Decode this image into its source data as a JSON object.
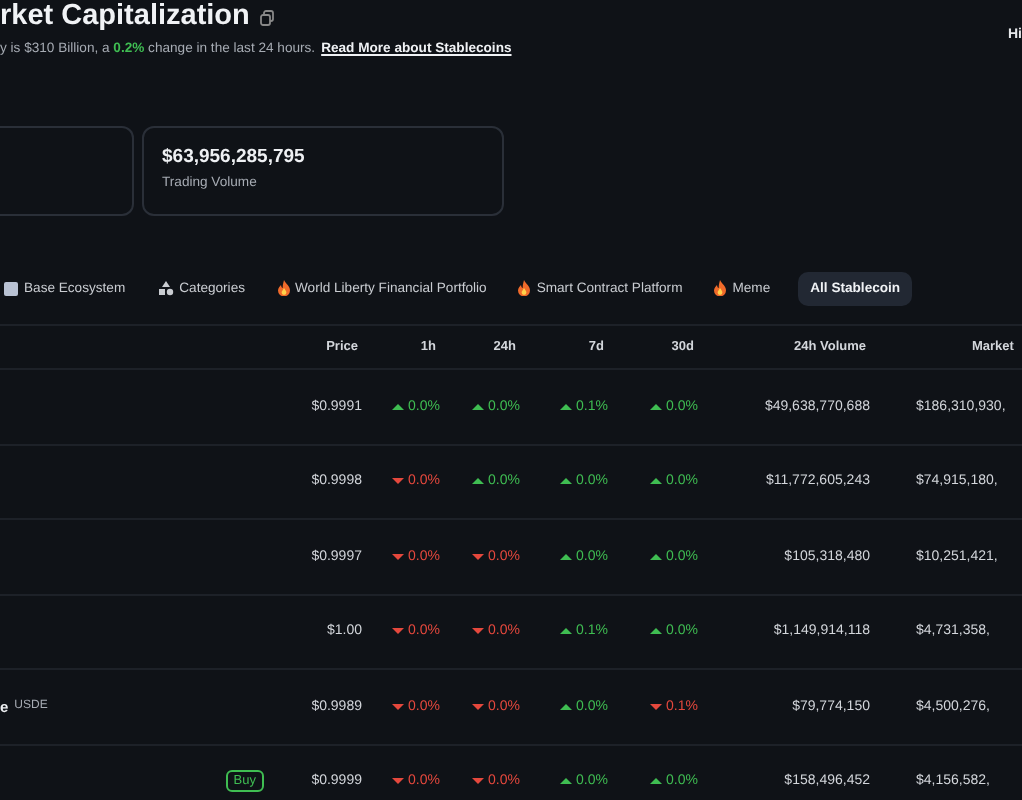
{
  "header": {
    "title": "rket Capitalization",
    "subtitle": {
      "before": "y is $310 Billion, a ",
      "highlight": "0.2%",
      "after": " change in the last 24 hours."
    },
    "link": "Read More about Stablecoins",
    "corner_text": "Hi"
  },
  "cards": [
    {
      "kind": "partial"
    },
    {
      "value": "$63,956,285,795",
      "label": "Trading Volume"
    }
  ],
  "tabs": [
    {
      "label": "Base Ecosystem",
      "kind": "square",
      "selected": false
    },
    {
      "label": "Categories",
      "kind": "shapes",
      "selected": false
    },
    {
      "label": "World Liberty Financial Portfolio",
      "kind": "fire",
      "selected": false
    },
    {
      "label": "Smart Contract Platform",
      "kind": "fire",
      "selected": false
    },
    {
      "label": "Meme",
      "kind": "fire",
      "selected": false
    },
    {
      "label": "All Stablecoin",
      "kind": "plain",
      "selected": true
    }
  ],
  "table": {
    "columns": [
      "Price",
      "1h",
      "24h",
      "7d",
      "30d",
      "24h Volume",
      "Market"
    ],
    "rows": [
      {
        "price": "$0.9991",
        "changes": [
          {
            "value": "0.0%",
            "kind": "up"
          },
          {
            "value": "0.0%",
            "kind": "up"
          },
          {
            "value": "0.1%",
            "kind": "up"
          },
          {
            "value": "0.0%",
            "kind": "up"
          }
        ],
        "volume": "$49,638,770,688",
        "market_cap": "$186,310,930,"
      },
      {
        "price": "$0.9998",
        "changes": [
          {
            "value": "0.0%",
            "kind": "down"
          },
          {
            "value": "0.0%",
            "kind": "up"
          },
          {
            "value": "0.0%",
            "kind": "up"
          },
          {
            "value": "0.0%",
            "kind": "up"
          }
        ],
        "volume": "$11,772,605,243",
        "market_cap": "$74,915,180,"
      },
      {
        "price": "$0.9997",
        "changes": [
          {
            "value": "0.0%",
            "kind": "down"
          },
          {
            "value": "0.0%",
            "kind": "down"
          },
          {
            "value": "0.0%",
            "kind": "up"
          },
          {
            "value": "0.0%",
            "kind": "up"
          }
        ],
        "volume": "$105,318,480",
        "market_cap": "$10,251,421,"
      },
      {
        "price": "$1.00",
        "changes": [
          {
            "value": "0.0%",
            "kind": "down"
          },
          {
            "value": "0.0%",
            "kind": "down"
          },
          {
            "value": "0.1%",
            "kind": "up"
          },
          {
            "value": "0.0%",
            "kind": "up"
          }
        ],
        "volume": "$1,149,914,118",
        "market_cap": "$4,731,358,"
      },
      {
        "name": "e",
        "symbol": "USDE",
        "price": "$0.9989",
        "changes": [
          {
            "value": "0.0%",
            "kind": "down"
          },
          {
            "value": "0.0%",
            "kind": "down"
          },
          {
            "value": "0.0%",
            "kind": "up"
          },
          {
            "value": "0.1%",
            "kind": "down"
          }
        ],
        "volume": "$79,774,150",
        "market_cap": "$4,500,276,"
      },
      {
        "buy": "Buy",
        "price": "$0.9999",
        "changes": [
          {
            "value": "0.0%",
            "kind": "down"
          },
          {
            "value": "0.0%",
            "kind": "down"
          },
          {
            "value": "0.0%",
            "kind": "up"
          },
          {
            "value": "0.0%",
            "kind": "up"
          }
        ],
        "volume": "$158,496,452",
        "market_cap": "$4,156,582,"
      }
    ]
  }
}
